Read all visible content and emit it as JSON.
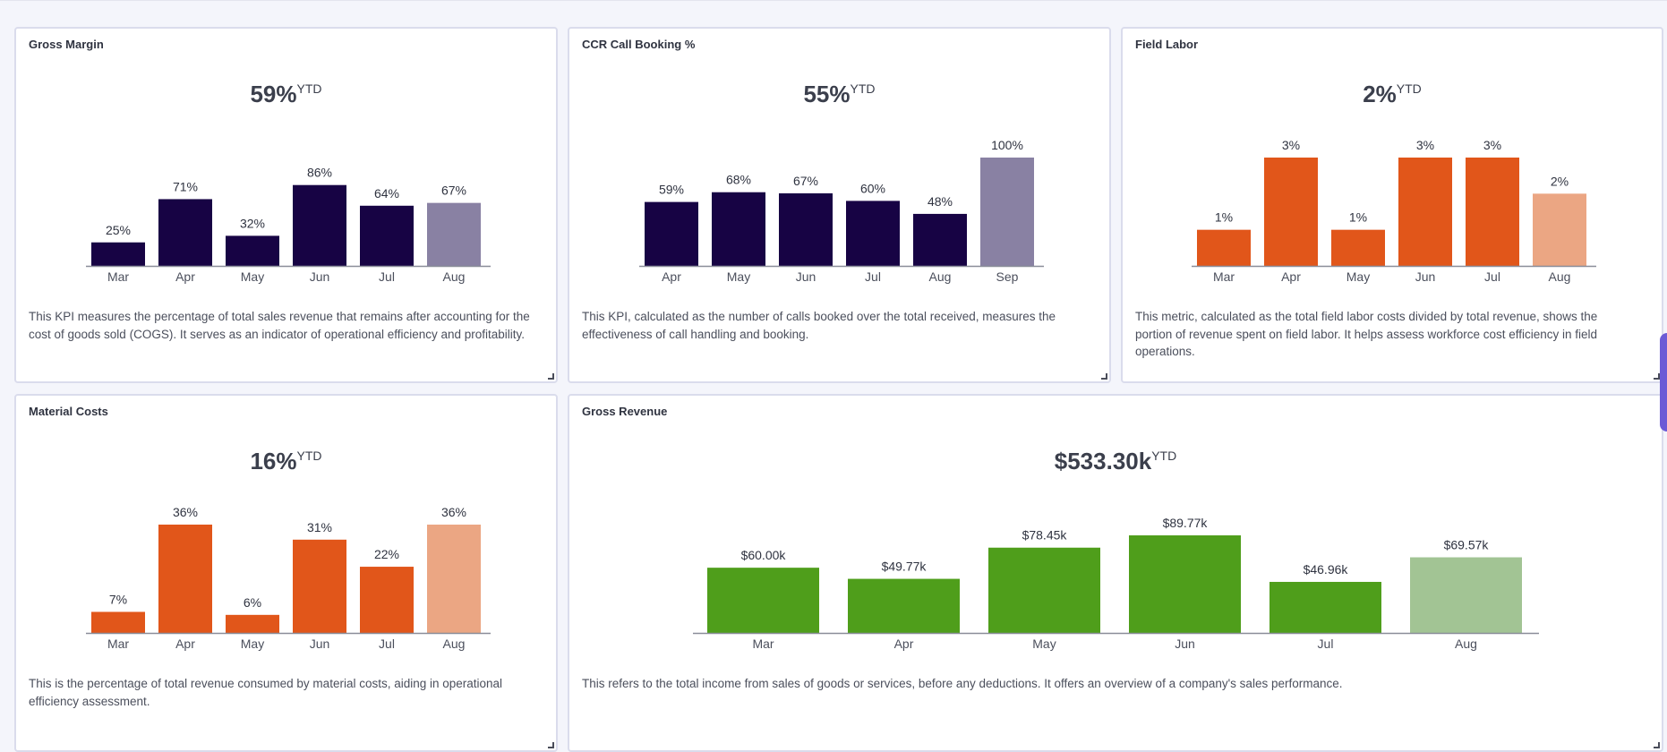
{
  "kpis": [
    {
      "title": "Gross Margin",
      "value": "59%",
      "suffix": "YTD",
      "description": "This KPI measures the percentage of total sales revenue that remains after accounting for the cost of goods sold (COGS). It serves as an indicator of operational efficiency and profitability."
    },
    {
      "title": "CCR Call Booking %",
      "value": "55%",
      "suffix": "YTD",
      "description": "This KPI, calculated as the number of calls booked over the total received, measures the effectiveness of call handling and booking."
    },
    {
      "title": "Field Labor",
      "value": "2%",
      "suffix": "YTD",
      "description": "This metric, calculated as the total field labor costs divided by total revenue, shows the portion of revenue spent on field labor. It helps assess workforce cost efficiency in field operations."
    },
    {
      "title": "Material Costs",
      "value": "16%",
      "suffix": "YTD",
      "description": "This is the percentage of total revenue consumed by material costs, aiding in operational efficiency assessment."
    },
    {
      "title": "Gross Revenue",
      "value": "$533.30k",
      "suffix": "YTD",
      "description": "This refers to the total income from sales of goods or services, before any deductions. It offers an overview of a company's sales performance."
    }
  ],
  "chart_data": [
    {
      "type": "bar",
      "categories": [
        "Mar",
        "Apr",
        "May",
        "Jun",
        "Jul",
        "Aug"
      ],
      "values": [
        25,
        71,
        32,
        86,
        64,
        67
      ],
      "labels": [
        "25%",
        "71%",
        "32%",
        "86%",
        "64%",
        "67%"
      ],
      "ylim": [
        0,
        100
      ],
      "bar_color": "#170344",
      "last_bar_color": "#8981a3"
    },
    {
      "type": "bar",
      "categories": [
        "Apr",
        "May",
        "Jun",
        "Jul",
        "Aug",
        "Sep"
      ],
      "values": [
        59,
        68,
        67,
        60,
        48,
        100
      ],
      "labels": [
        "59%",
        "68%",
        "67%",
        "60%",
        "48%",
        "100%"
      ],
      "ylim": [
        0,
        100
      ],
      "bar_color": "#170344",
      "last_bar_color": "#8981a3"
    },
    {
      "type": "bar",
      "categories": [
        "Mar",
        "Apr",
        "May",
        "Jun",
        "Jul",
        "Aug"
      ],
      "values": [
        1,
        3,
        1,
        3,
        3,
        2
      ],
      "labels": [
        "1%",
        "3%",
        "1%",
        "3%",
        "3%",
        "2%"
      ],
      "ylim": [
        0,
        3
      ],
      "bar_color": "#e1561a",
      "last_bar_color": "#eba683"
    },
    {
      "type": "bar",
      "categories": [
        "Mar",
        "Apr",
        "May",
        "Jun",
        "Jul",
        "Aug"
      ],
      "values": [
        7,
        36,
        6,
        31,
        22,
        36
      ],
      "labels": [
        "7%",
        "36%",
        "6%",
        "31%",
        "22%",
        "36%"
      ],
      "ylim": [
        0,
        36
      ],
      "bar_color": "#e1561a",
      "last_bar_color": "#eba683"
    },
    {
      "type": "bar",
      "categories": [
        "Mar",
        "Apr",
        "May",
        "Jun",
        "Jul",
        "Aug"
      ],
      "values": [
        60.0,
        49.77,
        78.45,
        89.77,
        46.96,
        69.57
      ],
      "labels": [
        "$60.00k",
        "$49.77k",
        "$78.45k",
        "$89.77k",
        "$46.96k",
        "$69.57k"
      ],
      "ylim": [
        0,
        89.77
      ],
      "bar_color": "#4f9e1b",
      "last_bar_color": "#a2c494"
    }
  ]
}
